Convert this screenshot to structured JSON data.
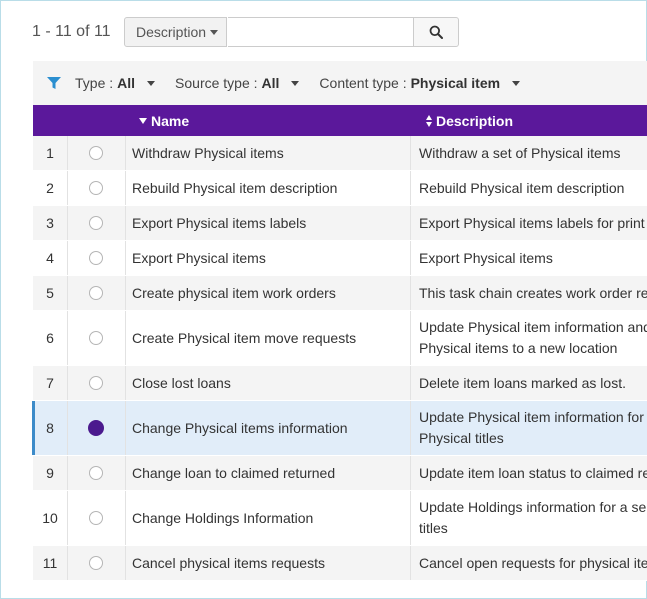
{
  "results": {
    "count_text": "1 - 11 of 11"
  },
  "search": {
    "field_label": "Description",
    "value": "",
    "placeholder": ""
  },
  "filters": [
    {
      "label": "Type :",
      "value": "All"
    },
    {
      "label": "Source type :",
      "value": "All"
    },
    {
      "label": "Content type :",
      "value": "Physical item"
    }
  ],
  "table": {
    "columns": [
      "Name",
      "Description"
    ],
    "header_color": "#5b189b",
    "rows": [
      {
        "num": "1",
        "name": "Withdraw Physical items",
        "desc": [
          "Withdraw a set of Physical items"
        ],
        "selected": false
      },
      {
        "num": "2",
        "name": "Rebuild Physical item description",
        "desc": [
          "Rebuild Physical item description"
        ],
        "selected": false
      },
      {
        "num": "3",
        "name": "Export Physical items labels",
        "desc": [
          "Export Physical items labels for print"
        ],
        "selected": false
      },
      {
        "num": "4",
        "name": "Export Physical items",
        "desc": [
          "Export Physical items"
        ],
        "selected": false
      },
      {
        "num": "5",
        "name": "Create physical item work orders",
        "desc": [
          "This task chain creates work order re"
        ],
        "selected": false
      },
      {
        "num": "6",
        "name": "Create Physical item move requests",
        "desc": [
          "Update Physical item information and",
          "Physical items to a new location"
        ],
        "selected": false
      },
      {
        "num": "7",
        "name": "Close lost loans",
        "desc": [
          "Delete item loans marked as lost."
        ],
        "selected": false
      },
      {
        "num": "8",
        "name": "Change Physical items information",
        "desc": [
          "Update Physical item information for",
          "Physical titles"
        ],
        "selected": true
      },
      {
        "num": "9",
        "name": "Change loan to claimed returned",
        "desc": [
          "Update item loan status to claimed re"
        ],
        "selected": false
      },
      {
        "num": "10",
        "name": "Change Holdings Information",
        "desc": [
          "Update Holdings information for a se",
          "titles"
        ],
        "selected": false
      },
      {
        "num": "11",
        "name": "Cancel physical items requests",
        "desc": [
          "Cancel open requests for physical ite"
        ],
        "selected": false
      }
    ]
  }
}
